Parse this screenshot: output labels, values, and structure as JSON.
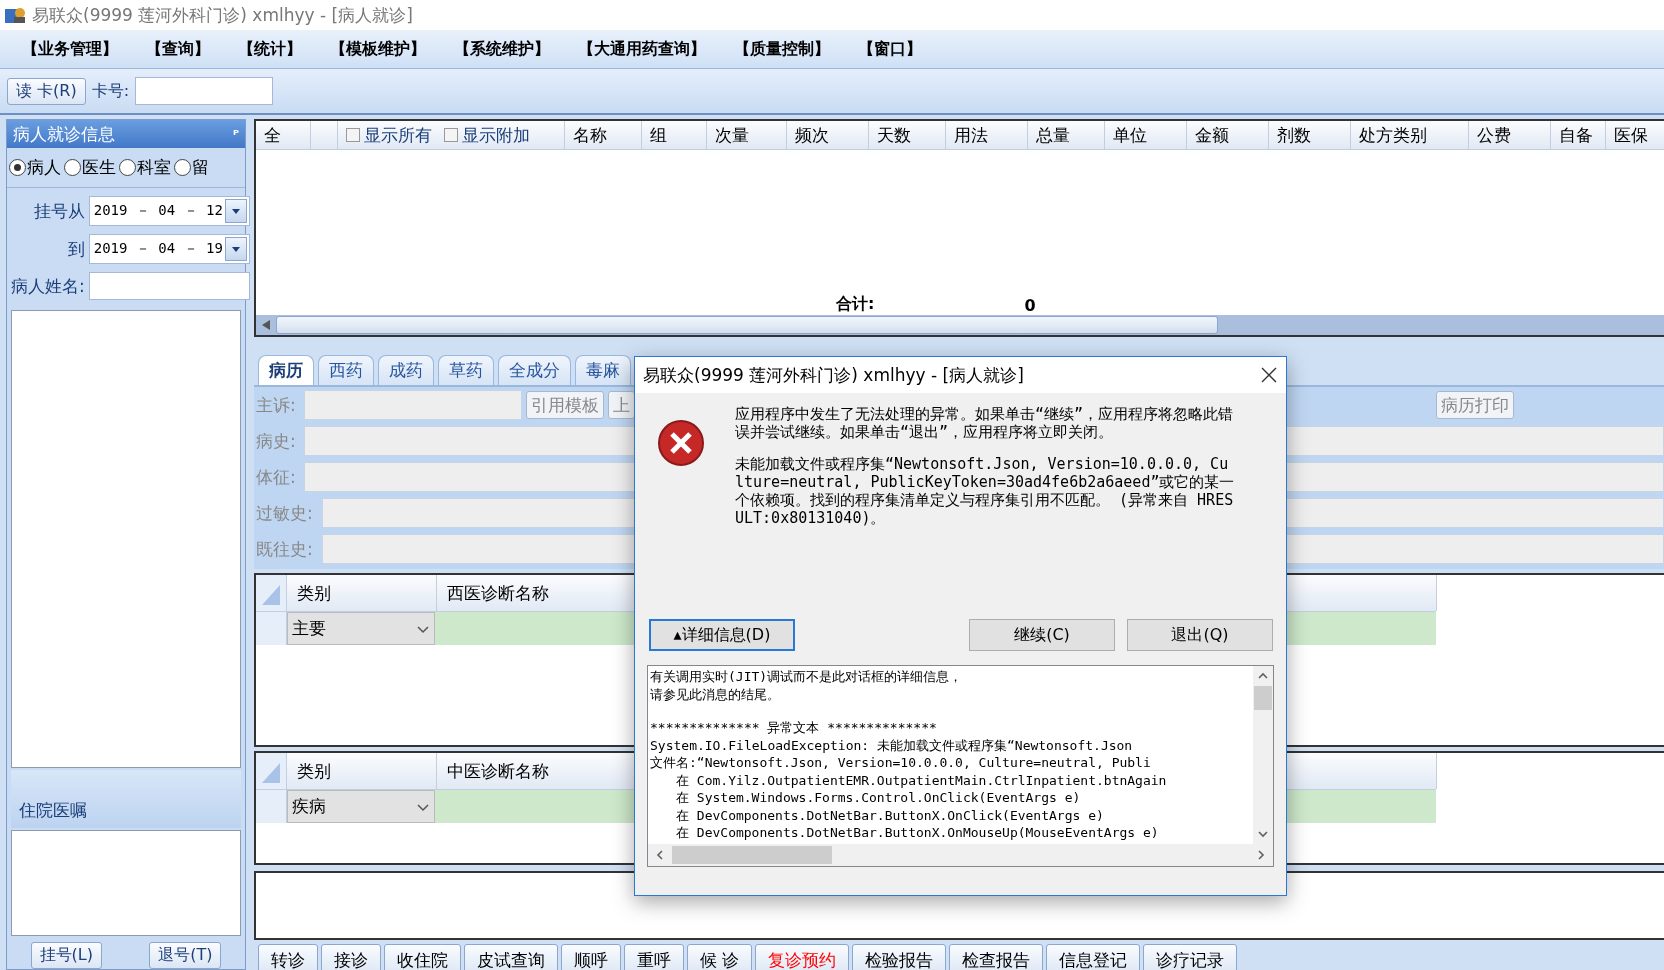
{
  "window": {
    "title": "易联众(9999 莲河外科门诊) xmlhyy - [病人就诊]"
  },
  "menu": [
    "【业务管理】",
    "【查询】",
    "【统计】",
    "【模板维护】",
    "【系统维护】",
    "【大通用药查询】",
    "【质量控制】",
    "【窗口】"
  ],
  "toolbar": {
    "read_card": "读 卡(R)",
    "card_label": "卡号:"
  },
  "sidebar": {
    "title": "病人就诊信息",
    "pin": "ᴾ",
    "radios": [
      {
        "label": "病人",
        "selected": true
      },
      {
        "label": "医生",
        "selected": false
      },
      {
        "label": "科室",
        "selected": false
      },
      {
        "label": "留",
        "selected": false
      }
    ],
    "from_label": "挂号从",
    "from_value": "2019 － 04 － 12",
    "to_label": "到",
    "to_value": "2019 － 04 － 19",
    "name_label": "病人姓名:",
    "section": "住院医嘱",
    "buttons": [
      "挂号(L)",
      "退号(T)"
    ]
  },
  "grid": {
    "select_all": "全",
    "checks": [
      {
        "label": "显示所有",
        "checked": false
      },
      {
        "label": "显示附加",
        "checked": false
      }
    ],
    "columns": [
      "名称",
      "组",
      "次量",
      "频次",
      "天数",
      "用法",
      "总量",
      "单位",
      "金额",
      "剂数",
      "处方类别",
      "公费",
      "自备",
      "医保"
    ],
    "total_label": "合计:",
    "total_value": "0"
  },
  "tabs": [
    {
      "label": "病历",
      "selected": true
    },
    {
      "label": "西药",
      "selected": false
    },
    {
      "label": "成药",
      "selected": false
    },
    {
      "label": "草药",
      "selected": false
    },
    {
      "label": "全成分",
      "selected": false
    },
    {
      "label": "毒麻",
      "selected": false
    }
  ],
  "form": {
    "fields": [
      "主诉:",
      "病史:",
      "体征:",
      "过敏史:",
      "既往史:"
    ],
    "template_button": "引用模板",
    "cut_button": "上",
    "print_button": "病历打印"
  },
  "diagnoses": [
    {
      "category_header": "类别",
      "name_header": "西医诊断名称",
      "category": "主要"
    },
    {
      "category_header": "类别",
      "name_header": "中医诊断名称",
      "category": "疾病"
    }
  ],
  "actions": [
    {
      "label": "转诊",
      "color": "#000000"
    },
    {
      "label": "接诊",
      "color": "#000000"
    },
    {
      "label": "收住院",
      "color": "#000000"
    },
    {
      "label": "皮试查询",
      "color": "#000000"
    },
    {
      "label": "顺呼",
      "color": "#000000"
    },
    {
      "label": "重呼",
      "color": "#000000"
    },
    {
      "label": "候 诊",
      "color": "#000000"
    },
    {
      "label": "复诊预约",
      "color": "#ff0000"
    },
    {
      "label": "检验报告",
      "color": "#000000"
    },
    {
      "label": "检查报告",
      "color": "#000000"
    },
    {
      "label": "信息登记",
      "color": "#000000"
    },
    {
      "label": "诊疗记录",
      "color": "#000000"
    }
  ],
  "dialog": {
    "title": "易联众(9999 莲河外科门诊) xmlhyy - [病人就诊]",
    "message": [
      "应用程序中发生了无法处理的异常。如果单击“继续”，应用程序将忽略此错误并尝试继续。如果单击“退出”，应用程序将立即关闭。",
      "未能加载文件或程序集“Newtonsoft.Json, Version=10.0.0.0, Culture=neutral, PublicKeyToken=30ad4fe6b2a6aeed”或它的某一个依赖项。找到的程序集清单定义与程序集引用不匹配。 (异常来自 HRESULT:0x80131040)。"
    ],
    "details_button": {
      "label": "▴详细信息(D)",
      "selected": true
    },
    "buttons": [
      "继续(C)",
      "退出(Q)"
    ],
    "details": [
      {
        "text": "有关调用实时(JIT)调试而不是此对话框的详细信息，",
        "kind": "plain"
      },
      {
        "text": "请参见此消息的结尾。",
        "kind": "plain"
      },
      {
        "text": "************** 异常文本 **************",
        "kind": "heading"
      },
      {
        "text": "System.IO.FileLoadException: 未能加载文件或程序集“Newtonsoft.Json",
        "kind": "plain"
      },
      {
        "text": "文件名:“Newtonsoft.Json, Version=10.0.0.0, Culture=neutral, Publi",
        "kind": "plain"
      },
      {
        "text": "在 Com.Yilz.OutpatientEMR.OutpatientMain.CtrlInpatient.btnAgain",
        "kind": "frame"
      },
      {
        "text": "在 System.Windows.Forms.Control.OnClick(EventArgs e)",
        "kind": "frame"
      },
      {
        "text": "在 DevComponents.DotNetBar.ButtonX.OnClick(EventArgs e)",
        "kind": "frame"
      },
      {
        "text": "在 DevComponents.DotNetBar.ButtonX.OnMouseUp(MouseEventArgs e)",
        "kind": "frame"
      }
    ]
  }
}
